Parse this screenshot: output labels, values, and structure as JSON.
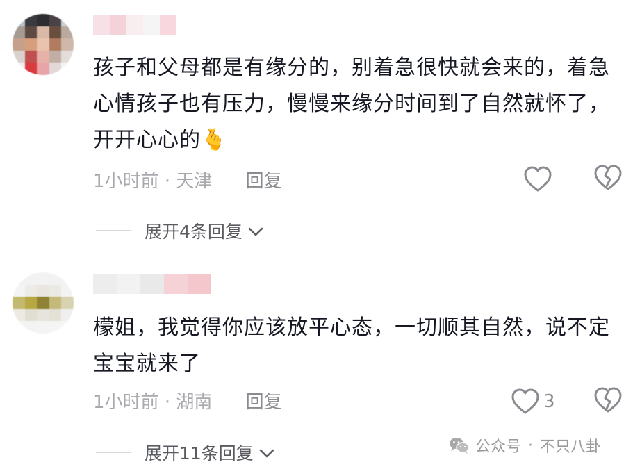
{
  "comments": [
    {
      "text": "孩子和父母都是有缘分的，别着急很快就会来的，着急心情孩子也有压力，慢慢来缘分时间到了自然就怀了，开开心心的",
      "emoji": "🫰",
      "time": "1小时前",
      "location": "天津",
      "reply_label": "回复",
      "like_count": "",
      "expand_label": "展开4条回复"
    },
    {
      "text": "檬姐，我觉得你应该放平心态，一切顺其自然，说不定宝宝就来了",
      "time": "1小时前",
      "location": "湖南",
      "reply_label": "回复",
      "like_count": "3",
      "expand_label": "展开11条回复"
    }
  ],
  "watermark": {
    "platform": "公众号",
    "account": "不只八卦"
  },
  "colors": {
    "text": "#161823",
    "meta": "#a8a9ad",
    "icon": "#8a8b90"
  },
  "icons": [
    "heart-icon",
    "broken-heart-icon",
    "chevron-down-icon",
    "wechat-icon"
  ]
}
